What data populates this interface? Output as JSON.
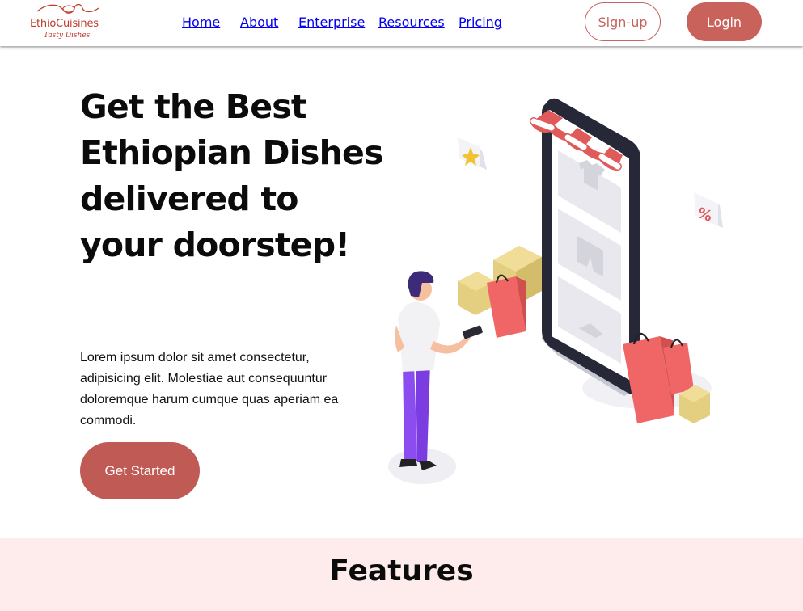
{
  "brand": {
    "name": "EthioCuisines",
    "tagline": "Tasty Dishes",
    "color": "#c0392b"
  },
  "nav": {
    "links": [
      "Home",
      "About",
      "Enterprise",
      "Resources",
      "Pricing"
    ],
    "signup_label": "Sign-up",
    "login_label": "Login"
  },
  "hero": {
    "title": "Get the Best Ethiopian Dishes delivered to your doorstep!",
    "text": "Lorem ipsum dolor sit amet consectetur, adipisicing elit. Molestiae aut consequuntur doloremque harum cumque quas aperiam ea commodi.",
    "cta_label": "Get Started"
  },
  "features": {
    "title": "Features"
  },
  "colors": {
    "accent": "#c9625b",
    "features_bg": "#fdeceb"
  },
  "illustration": {
    "icons": [
      "star-icon",
      "percent-icon",
      "shirt-icon",
      "shorts-icon"
    ]
  }
}
